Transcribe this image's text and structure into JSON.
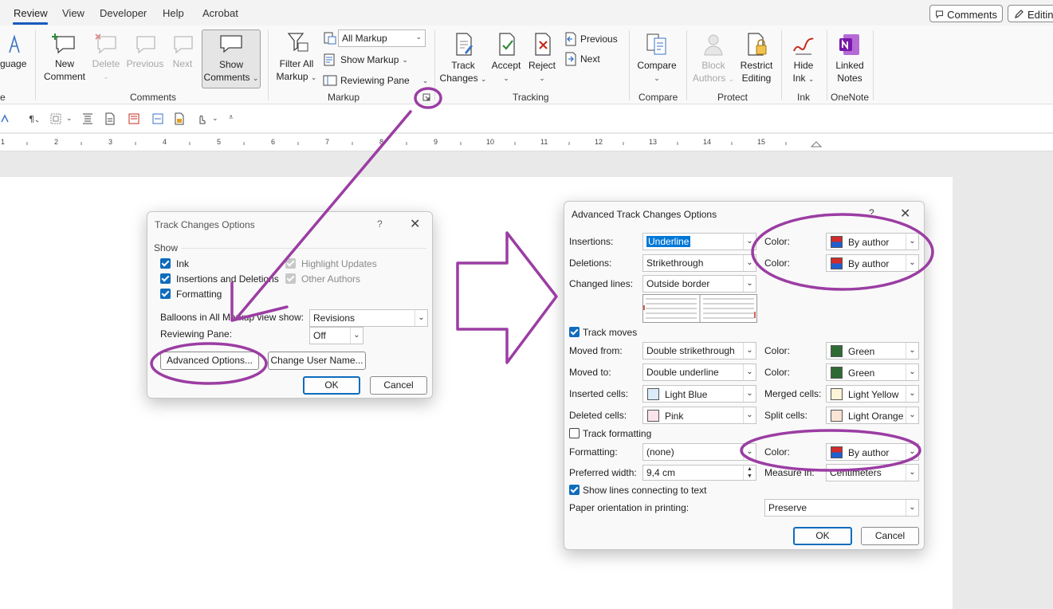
{
  "tabs": [
    "Review",
    "View",
    "Developer",
    "Help",
    "Acrobat"
  ],
  "top_right": {
    "comments": "Comments",
    "editing": "Editin"
  },
  "ribbon": {
    "language_partial": "guage",
    "new_comment": [
      "New",
      "Comment"
    ],
    "delete": "Delete",
    "previous": "Previous",
    "next": "Next",
    "show_comments": [
      "Show",
      "Comments"
    ],
    "comments_group": "Comments",
    "filter_all_markup": [
      "Filter All",
      "Markup"
    ],
    "all_markup": "All Markup",
    "show_markup": "Show Markup",
    "reviewing_pane": "Reviewing Pane",
    "markup_group": "Markup",
    "track_changes": [
      "Track",
      "Changes"
    ],
    "accept": "Accept",
    "reject": "Reject",
    "tr_previous": "Previous",
    "tr_next": "Next",
    "tracking_group": "Tracking",
    "compare": "Compare",
    "compare_group": "Compare",
    "block_authors": [
      "Block",
      "Authors"
    ],
    "restrict_editing": [
      "Restrict",
      "Editing"
    ],
    "protect_group": "Protect",
    "hide_ink": [
      "Hide",
      "Ink"
    ],
    "ink_group": "Ink",
    "linked_notes": [
      "Linked",
      "Notes"
    ],
    "onenote_group": "OneNote",
    "partial_e": "e"
  },
  "ruler_numbers": [
    "1",
    "2",
    "3",
    "4",
    "5",
    "6",
    "7",
    "8",
    "9",
    "10",
    "11",
    "12",
    "13",
    "14",
    "15"
  ],
  "tco": {
    "title": "Track Changes Options",
    "help": "?",
    "show_label": "Show",
    "ink": "Ink",
    "insdel": "Insertions and Deletions",
    "formatting": "Formatting",
    "highlight": "Highlight Updates",
    "other_authors": "Other Authors",
    "balloons_label": "Balloons in All Markup view show:",
    "balloons_value": "Revisions",
    "pane_label": "Reviewing Pane:",
    "pane_value": "Off",
    "advanced": "Advanced Options...",
    "change_user": "Change User Name...",
    "ok": "OK",
    "cancel": "Cancel"
  },
  "atco": {
    "title": "Advanced Track Changes Options",
    "help": "?",
    "insertions_label": "Insertions:",
    "insertions_value": "Underline",
    "deletions_label": "Deletions:",
    "deletions_value": "Strikethrough",
    "changed_lines_label": "Changed lines:",
    "changed_lines_value": "Outside border",
    "color_label": "Color:",
    "by_author": "By author",
    "track_moves": "Track moves",
    "moved_from_label": "Moved from:",
    "moved_from_value": "Double strikethrough",
    "moved_to_label": "Moved to:",
    "moved_to_value": "Double underline",
    "green": "Green",
    "inserted_cells_label": "Inserted cells:",
    "inserted_cells_value": "Light Blue",
    "deleted_cells_label": "Deleted cells:",
    "deleted_cells_value": "Pink",
    "merged_cells_label": "Merged cells:",
    "merged_cells_value": "Light Yellow",
    "split_cells_label": "Split cells:",
    "split_cells_value": "Light Orange",
    "track_formatting": "Track formatting",
    "formatting_label": "Formatting:",
    "formatting_value": "(none)",
    "preferred_width_label": "Preferred width:",
    "preferred_width_value": "9,4 cm",
    "measure_in_label": "Measure in:",
    "measure_in_value": "Centimeters",
    "show_lines": "Show lines connecting to text",
    "paper_orient_label": "Paper orientation in printing:",
    "paper_orient_value": "Preserve",
    "ok": "OK",
    "cancel": "Cancel"
  },
  "colors": {
    "accent": "#185abd",
    "annotation": "#9b3da3",
    "green": "#2e6b34",
    "light_blue": "#dcebf8",
    "pink": "#fbe3ee",
    "light_yellow": "#fdf3d7",
    "light_orange": "#fbe4d6"
  }
}
